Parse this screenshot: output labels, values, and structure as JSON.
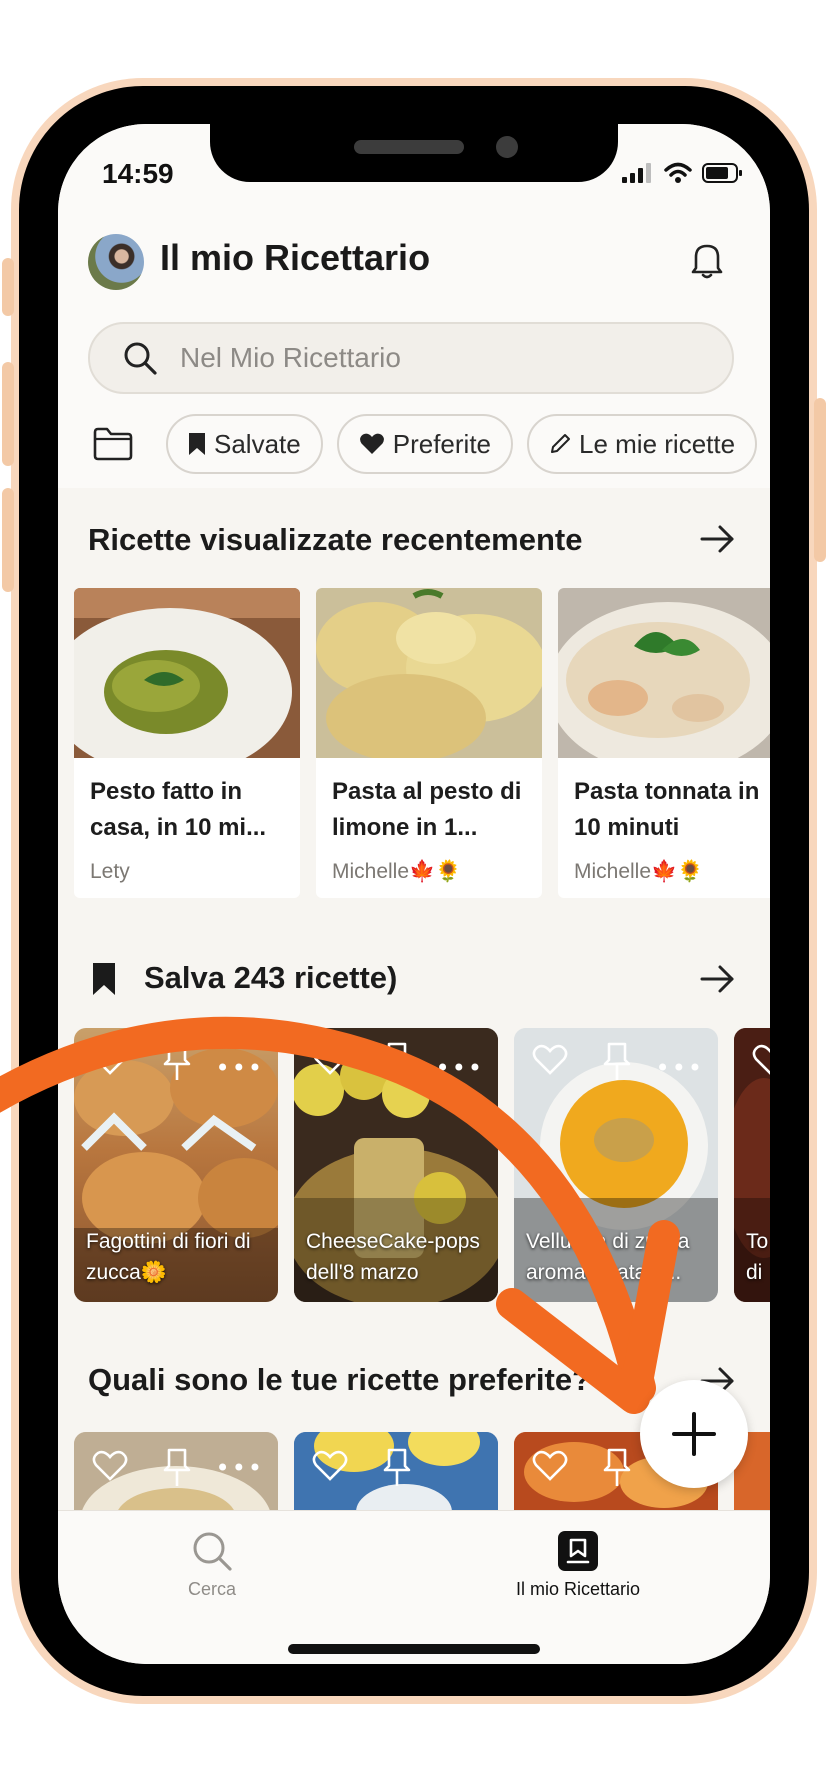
{
  "status_bar": {
    "time": "14:59"
  },
  "header": {
    "title": "Il mio Ricettario",
    "search_placeholder": "Nel Mio Ricettario"
  },
  "filters": [
    {
      "label": "Salvate",
      "icon": "bookmark-icon"
    },
    {
      "label": "Preferite",
      "icon": "heart-icon"
    },
    {
      "label": "Le mie ricette",
      "icon": "pencil-icon"
    }
  ],
  "recent": {
    "title": "Ricette visualizzate recentemente",
    "items": [
      {
        "title": "Pesto fatto in casa, in 10 mi...",
        "author": "Lety"
      },
      {
        "title": "Pasta al pesto di limone in 1...",
        "author": "Michelle🍁🌻"
      },
      {
        "title": "Pasta tonnata in 10 minuti",
        "author": "Michelle🍁🌻"
      }
    ]
  },
  "saved": {
    "title": "Salva 243 ricette)",
    "items": [
      {
        "caption": "Fagottini di fiori di zucca🌼"
      },
      {
        "caption": "CheeseCake-pops dell'8 marzo"
      },
      {
        "caption": "Vellutata di zucca aromatizzata a..."
      },
      {
        "caption": "To di"
      }
    ]
  },
  "favorites": {
    "title": "Quali sono le tue ricette preferite?"
  },
  "tabbar": {
    "search_label": "Cerca",
    "cookbook_label": "Il mio Ricettario"
  },
  "colors": {
    "phone_frame": "#f8d7bd",
    "annotation_arrow": "#f26a21",
    "background": "#f7f5f1"
  }
}
